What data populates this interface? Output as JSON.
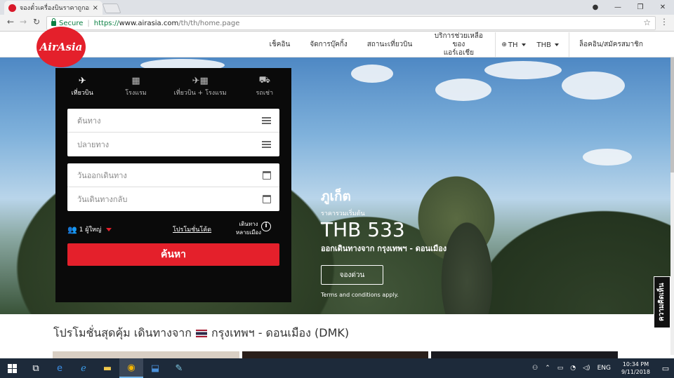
{
  "browser": {
    "tab_title": "จองตั๋วเครื่องบินราคาถูกออนไล...",
    "tab_close": "×",
    "secure_label": "Secure",
    "url_protocol": "https://",
    "url_host": "www.airasia.com",
    "url_path": "/th/th/home.page"
  },
  "header": {
    "logo_text": "AirAsia",
    "nav": {
      "checkin": "เช็คอิน",
      "manage": "จัดการบุ๊คกิ้ง",
      "flight_status": "สถานะเที่ยวบิน",
      "help_line1": "บริการช่วยเหลือของ",
      "help_line2": "แอร์เอเชีย",
      "language": "TH",
      "currency": "THB",
      "login": "ล็อคอิน/สมัครสมาชิก"
    }
  },
  "search": {
    "tabs": [
      {
        "label": "เที่ยวบิน",
        "icon": "plane-icon"
      },
      {
        "label": "โรงแรม",
        "icon": "hotel-icon"
      },
      {
        "label": "เที่ยวบิน + โรงแรม",
        "icon": "flight-hotel-icon"
      },
      {
        "label": "รถเช่า",
        "icon": "car-icon"
      }
    ],
    "origin_placeholder": "ต้นทาง",
    "destination_placeholder": "ปลายทาง",
    "depart_placeholder": "วันออกเดินทาง",
    "return_placeholder": "วันเดินทางกลับ",
    "passengers": "1 ผู้ใหญ่",
    "promo_code": "โปรโมชั่นโค้ด",
    "multicity_line1": "เดินทาง",
    "multicity_line2": "หลายเมือง",
    "info_symbol": "i",
    "search_button": "ค้นหา"
  },
  "promo": {
    "city": "ภูเก็ต",
    "from_label": "ราคารวมเริ่มต้น",
    "price": "THB 533",
    "route": "ออกเดินทางจาก กรุงเทพฯ - ดอนเมือง",
    "book_button": "จองด่วน",
    "terms": "Terms and conditions apply."
  },
  "feedback_tab": "ความคิดเห็น",
  "promotions_section": {
    "title_prefix": "โปรโมชั่นสุดคุ้ม เดินทางจาก",
    "title_suffix": "กรุงเทพฯ - ดอนเมือง (DMK)"
  },
  "taskbar": {
    "language": "ENG",
    "time": "10:34 PM",
    "date": "9/11/2018"
  },
  "colors": {
    "brand_red": "#e4202b",
    "panel_black": "#0a0a0a",
    "taskbar": "#1d2a3a"
  }
}
